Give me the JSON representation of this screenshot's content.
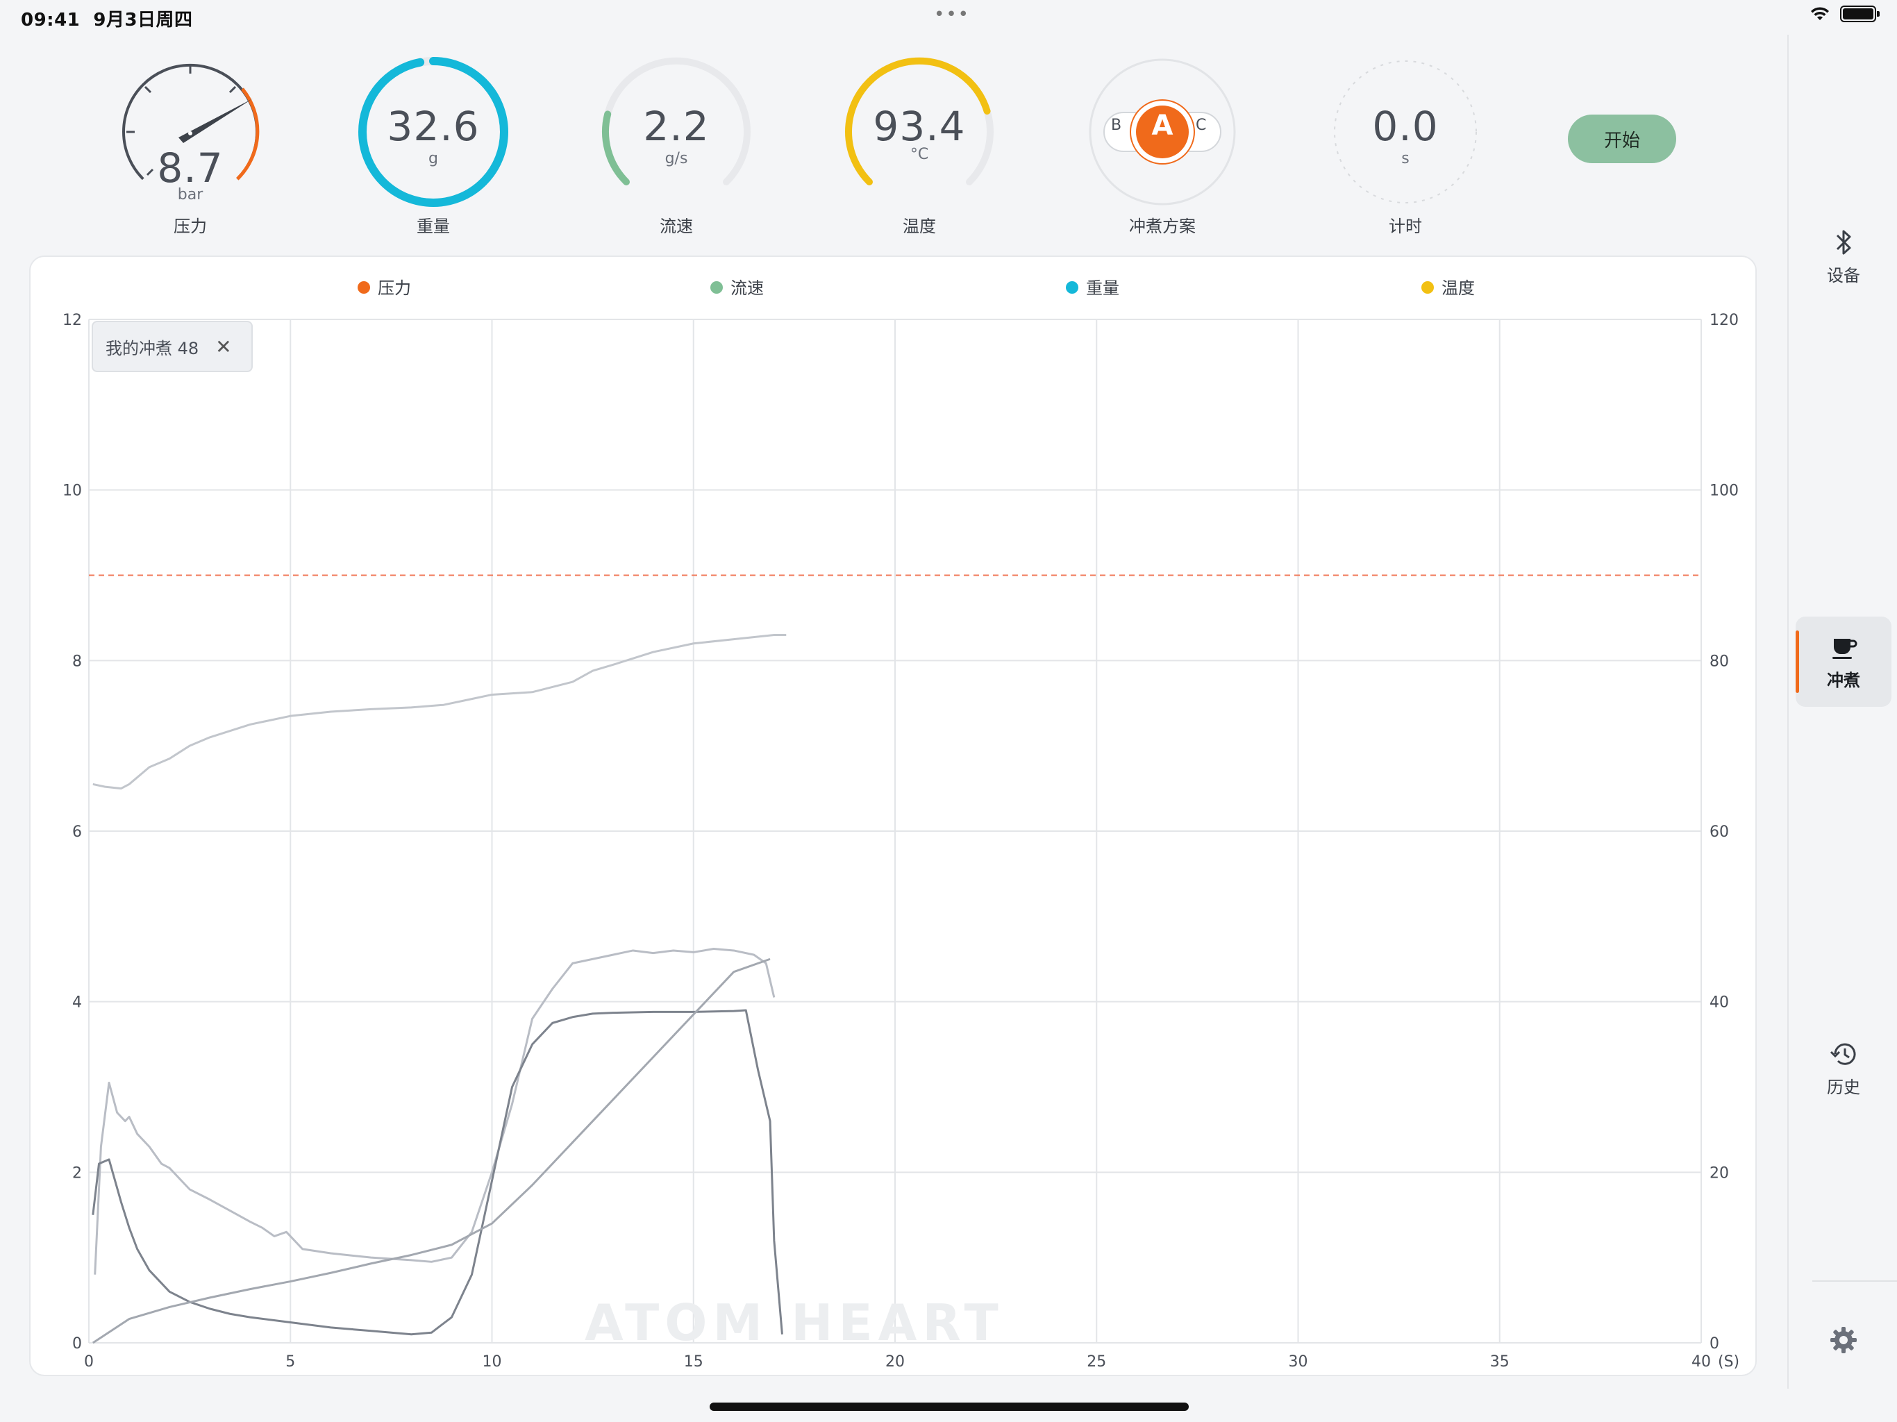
{
  "status_bar": {
    "time": "09:41",
    "date": "9月3日周四",
    "dots": "•••"
  },
  "gauges": {
    "pressure": {
      "value": "8.7",
      "unit": "bar",
      "label": "压力",
      "fraction": 0.725
    },
    "weight": {
      "value": "32.6",
      "unit": "g",
      "label": "重量",
      "fraction": 0.97
    },
    "flow": {
      "value": "2.2",
      "unit": "g/s",
      "label": "流速",
      "fraction": 0.22
    },
    "temperature": {
      "value": "93.4",
      "unit": "°C",
      "label": "温度",
      "fraction": 0.77
    },
    "profile": {
      "selected": "A",
      "left": "B",
      "right": "C",
      "label": "冲煮方案"
    },
    "timer": {
      "value": "0.0",
      "unit": "s",
      "label": "计时"
    }
  },
  "start_button": "开始",
  "tag_chip": {
    "label": "我的冲煮 48"
  },
  "watermark": "ATOM HEART",
  "colors": {
    "pressure": "#f06a1b",
    "flow": "#7fbf95",
    "weight": "#14b8d9",
    "temperature": "#f2c012",
    "start": "#8cc0a0",
    "accent": "#f06a1b"
  },
  "sidebar": {
    "items": [
      {
        "label": "设备",
        "icon": "bluetooth-icon"
      },
      {
        "label": "冲煮",
        "icon": "coffee-cup-icon",
        "active": true
      },
      {
        "label": "历史",
        "icon": "history-icon"
      }
    ],
    "settings_icon": "gear-icon"
  },
  "chart_data": {
    "type": "line",
    "legend": [
      "压力",
      "流速",
      "重量",
      "温度"
    ],
    "legend_colors": [
      "#f06a1b",
      "#7fbf95",
      "#14b8d9",
      "#f2c012"
    ],
    "x_ticks": [
      "0",
      "5",
      "10",
      "15",
      "20",
      "25",
      "30",
      "35",
      "40"
    ],
    "x_unit": "(S)",
    "xlim": [
      0,
      40
    ],
    "y_left_ticks": [
      "0",
      "2",
      "4",
      "6",
      "8",
      "10",
      "12"
    ],
    "ylim_left": [
      0,
      12
    ],
    "y_right_ticks": [
      "0",
      "20",
      "40",
      "60",
      "80",
      "100",
      "120"
    ],
    "ylim_right": [
      0,
      120
    ],
    "reference_line_left": 9,
    "grid": true,
    "series": [
      {
        "axis": "left",
        "color": "#b9bdc5",
        "x": [
          0.15,
          0.3,
          0.5,
          0.7,
          0.9,
          1.0,
          1.2,
          1.5,
          1.8,
          2.0,
          2.5,
          3.0,
          3.5,
          4.0,
          4.3,
          4.6,
          4.9,
          5.3,
          6.0,
          7.0,
          8.0,
          8.5,
          9.0,
          9.5,
          10.0,
          10.5,
          11.0,
          11.5,
          12.0,
          12.5,
          13.0,
          13.5,
          14.0,
          14.5,
          15.0,
          15.5,
          16.0,
          16.5,
          16.8,
          17.0
        ],
        "y": [
          0.8,
          2.3,
          3.05,
          2.7,
          2.6,
          2.65,
          2.45,
          2.3,
          2.1,
          2.05,
          1.8,
          1.68,
          1.55,
          1.42,
          1.35,
          1.25,
          1.3,
          1.1,
          1.05,
          1.0,
          0.97,
          0.95,
          1.0,
          1.3,
          2.0,
          2.8,
          3.8,
          4.15,
          4.45,
          4.5,
          4.55,
          4.6,
          4.57,
          4.6,
          4.58,
          4.62,
          4.6,
          4.55,
          4.45,
          4.05
        ]
      },
      {
        "axis": "left",
        "color": "#7d838d",
        "x": [
          0.1,
          0.25,
          0.5,
          0.8,
          1.0,
          1.2,
          1.5,
          2.0,
          2.5,
          3.0,
          3.5,
          4.0,
          5.0,
          6.0,
          7.0,
          8.0,
          8.5,
          9.0,
          9.5,
          10.0,
          10.5,
          11.0,
          11.5,
          12.0,
          12.5,
          13.0,
          14.0,
          15.0,
          16.0,
          16.3,
          16.6,
          16.9,
          17.0,
          17.2
        ],
        "y": [
          1.5,
          2.1,
          2.15,
          1.65,
          1.35,
          1.1,
          0.85,
          0.6,
          0.48,
          0.4,
          0.34,
          0.3,
          0.24,
          0.18,
          0.14,
          0.1,
          0.12,
          0.3,
          0.8,
          1.9,
          3.0,
          3.5,
          3.75,
          3.82,
          3.86,
          3.87,
          3.88,
          3.88,
          3.89,
          3.9,
          3.2,
          2.6,
          1.2,
          0.1
        ]
      },
      {
        "axis": "right",
        "color": "#a3a8b0",
        "x": [
          0.1,
          1.0,
          2.0,
          3.0,
          4.0,
          5.0,
          6.0,
          7.0,
          8.0,
          9.0,
          10.0,
          11.0,
          12.0,
          13.0,
          14.0,
          15.0,
          16.0,
          16.9
        ],
        "y": [
          0.0,
          2.8,
          4.2,
          5.3,
          6.3,
          7.2,
          8.2,
          9.3,
          10.3,
          11.5,
          14.0,
          18.5,
          23.5,
          28.5,
          33.5,
          38.5,
          43.5,
          45.0
        ]
      },
      {
        "axis": "right",
        "color": "#c2c6cc",
        "x": [
          0.1,
          0.4,
          0.8,
          1.0,
          1.5,
          2.0,
          2.5,
          3.0,
          4.0,
          5.0,
          6.0,
          7.0,
          8.0,
          8.8,
          9.5,
          10.0,
          11.0,
          12.0,
          12.5,
          13.0,
          14.0,
          15.0,
          16.0,
          17.0,
          17.3
        ],
        "y": [
          65.5,
          65.2,
          65.0,
          65.5,
          67.5,
          68.5,
          70.0,
          71.0,
          72.5,
          73.5,
          74.0,
          74.3,
          74.5,
          74.8,
          75.5,
          76.0,
          76.3,
          77.5,
          78.8,
          79.5,
          81.0,
          82.0,
          82.5,
          83.0,
          83.0
        ]
      }
    ]
  }
}
